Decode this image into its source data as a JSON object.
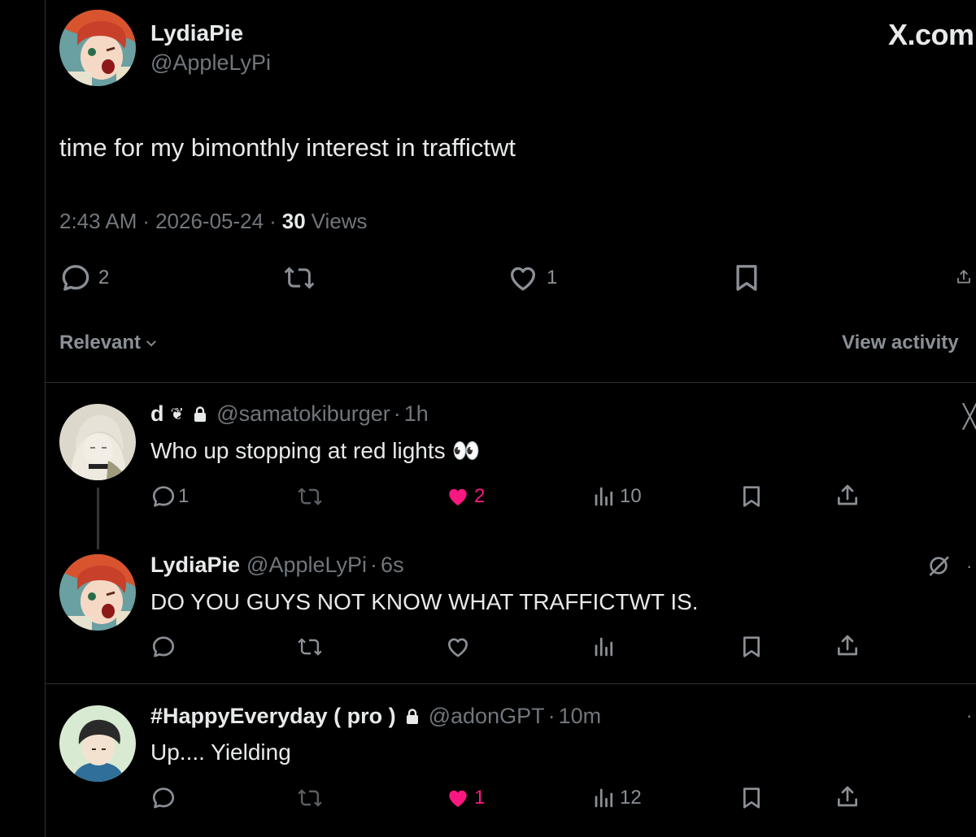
{
  "watermark": "X.com",
  "main_tweet": {
    "display_name": "LydiaPie",
    "handle": "@AppleLyPi",
    "text": "time for my bimonthly interest in traffictwt",
    "time": "2:43 AM",
    "sep1": "·",
    "date": "2026-05-24",
    "sep2": "·",
    "views_count": "30",
    "views_label": "Views",
    "replies": "2",
    "likes": "1"
  },
  "sort": {
    "label": "Relevant",
    "view_activity": "View activity"
  },
  "replies": [
    {
      "display_name": "d",
      "handle": "@samatokiburger",
      "sep": "·",
      "time": "1h",
      "text": "Who up stopping at red lights 👀",
      "reply_count": "1",
      "like_count": "2",
      "view_count": "10",
      "liked": true
    },
    {
      "display_name": "LydiaPie",
      "handle": "@AppleLyPi",
      "sep": "·",
      "time": "6s",
      "text": "DO YOU GUYS NOT KNOW WHAT TRAFFICTWT IS."
    },
    {
      "display_name": "#HappyEveryday ( pro )",
      "handle": "@adonGPT",
      "sep": "·",
      "time": "10m",
      "text": "Up.... Yielding",
      "like_count": "1",
      "view_count": "12",
      "liked": true
    }
  ],
  "colors": {
    "background": "#000000",
    "text": "#e7e9ea",
    "muted": "#71767b",
    "like": "#f91880",
    "divider": "#2f3336"
  },
  "icons": [
    "reply-icon",
    "retweet-icon",
    "heart-icon",
    "bookmark-icon",
    "share-icon",
    "views-icon",
    "lock-icon",
    "chevron-down-icon",
    "grok-icon",
    "close-icon",
    "more-icon"
  ]
}
